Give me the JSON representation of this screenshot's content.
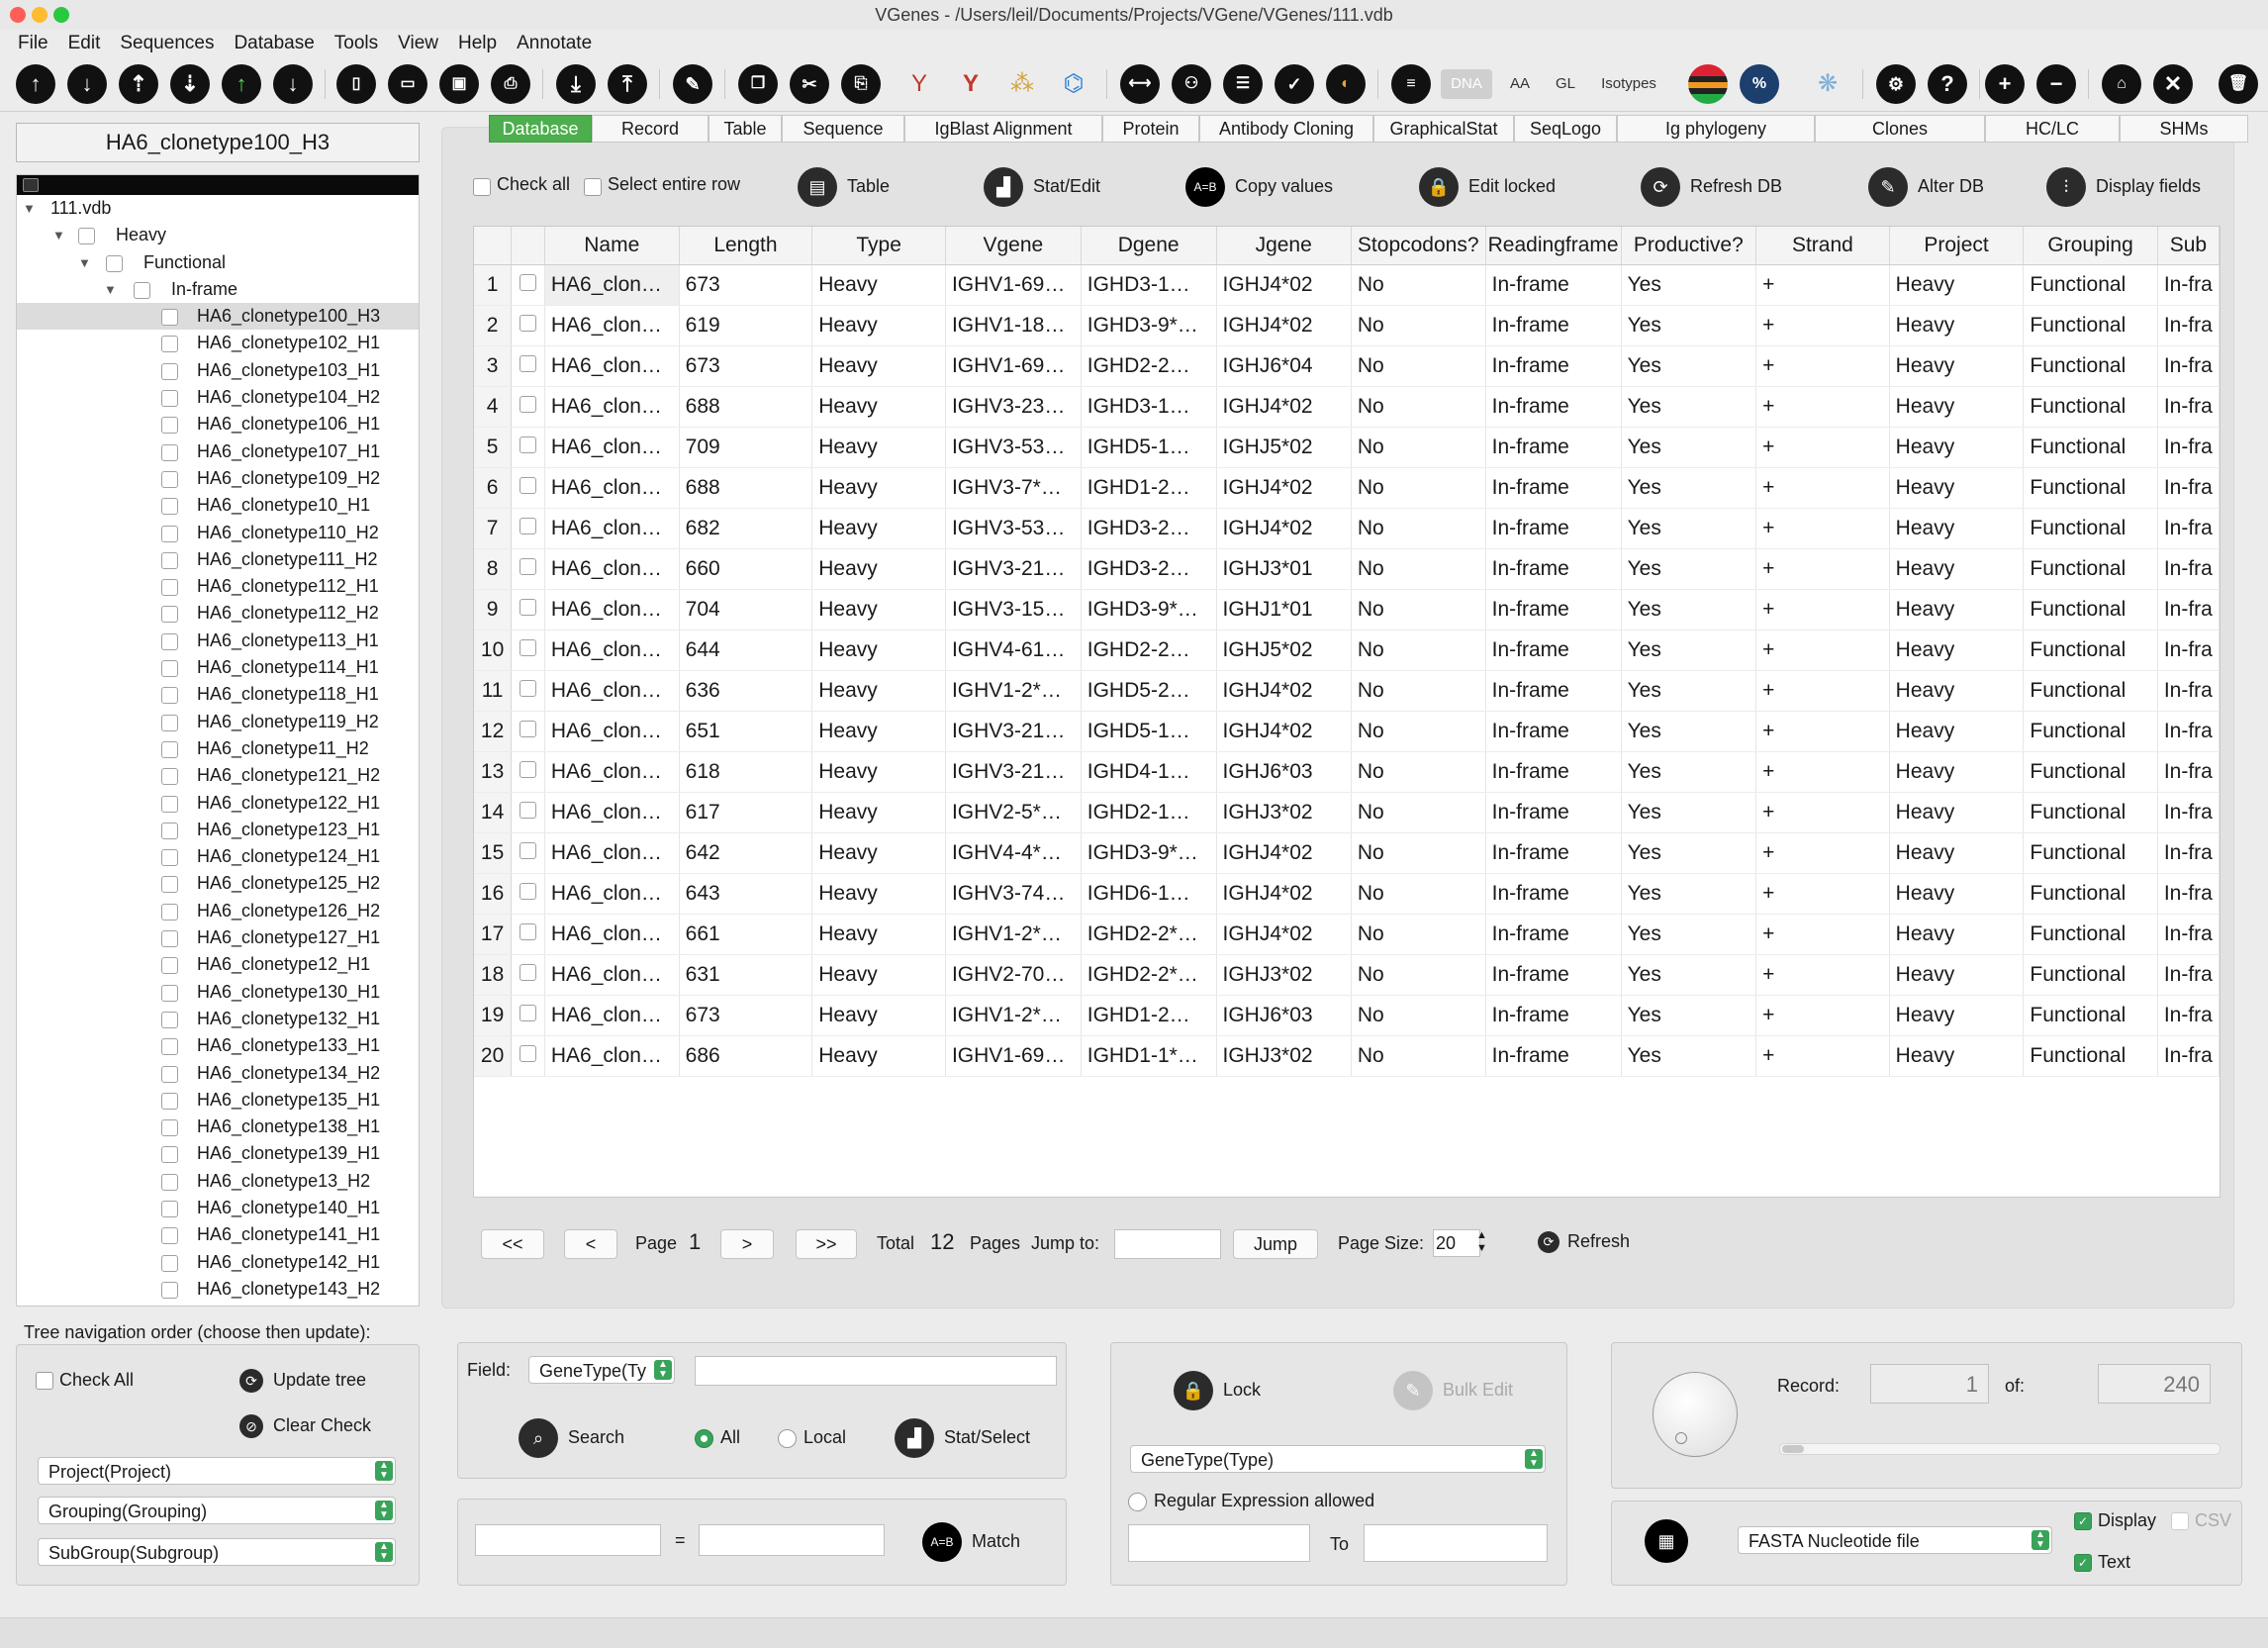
{
  "window": {
    "title": "VGenes - /Users/leil/Documents/Projects/VGene/VGenes/111.vdb"
  },
  "menu": [
    "File",
    "Edit",
    "Sequences",
    "Database",
    "Tools",
    "View",
    "Help",
    "Annotate"
  ],
  "toolbar": {
    "dna": "DNA",
    "aa": "AA",
    "gl": "GL",
    "isotypes": "Isotypes"
  },
  "sequence_name": "HA6_clonetype100_H3",
  "tree": {
    "root": "111.vdb",
    "level1": "Heavy",
    "level2": "Functional",
    "level3": "In-frame",
    "leaves": [
      "HA6_clonetype100_H3",
      "HA6_clonetype102_H1",
      "HA6_clonetype103_H1",
      "HA6_clonetype104_H2",
      "HA6_clonetype106_H1",
      "HA6_clonetype107_H1",
      "HA6_clonetype109_H2",
      "HA6_clonetype10_H1",
      "HA6_clonetype110_H2",
      "HA6_clonetype111_H2",
      "HA6_clonetype112_H1",
      "HA6_clonetype112_H2",
      "HA6_clonetype113_H1",
      "HA6_clonetype114_H1",
      "HA6_clonetype118_H1",
      "HA6_clonetype119_H2",
      "HA6_clonetype11_H2",
      "HA6_clonetype121_H2",
      "HA6_clonetype122_H1",
      "HA6_clonetype123_H1",
      "HA6_clonetype124_H1",
      "HA6_clonetype125_H2",
      "HA6_clonetype126_H2",
      "HA6_clonetype127_H1",
      "HA6_clonetype12_H1",
      "HA6_clonetype130_H1",
      "HA6_clonetype132_H1",
      "HA6_clonetype133_H1",
      "HA6_clonetype134_H2",
      "HA6_clonetype135_H1",
      "HA6_clonetype138_H1",
      "HA6_clonetype139_H1",
      "HA6_clonetype13_H2",
      "HA6_clonetype140_H1",
      "HA6_clonetype141_H1",
      "HA6_clonetype142_H1",
      "HA6_clonetype143_H2"
    ]
  },
  "tabs": [
    "Database",
    "Record",
    "Table",
    "Sequence",
    "IgBlast Alignment",
    "Protein",
    "Antibody Cloning",
    "GraphicalStat",
    "SeqLogo",
    "Ig phylogeny",
    "Clones",
    "HC/LC",
    "SHMs"
  ],
  "db_controls": {
    "check_all": "Check all",
    "select_row": "Select entire row",
    "table": "Table",
    "stat_edit": "Stat/Edit",
    "copy_values": "Copy values",
    "edit_locked": "Edit locked",
    "refresh_db": "Refresh DB",
    "alter_db": "Alter DB",
    "display_fields": "Display fields"
  },
  "grid": {
    "columns": [
      "Name",
      "Length",
      "Type",
      "Vgene",
      "Dgene",
      "Jgene",
      "Stopcodons?",
      "Readingframe",
      "Productive?",
      "Strand",
      "Project",
      "Grouping",
      "Sub"
    ],
    "rows": [
      [
        "1",
        "HA6_clon…",
        "673",
        "Heavy",
        "IGHV1-69…",
        "IGHD3-1…",
        "IGHJ4*02",
        "No",
        "In-frame",
        "Yes",
        "+",
        "Heavy",
        "Functional",
        "In-fra"
      ],
      [
        "2",
        "HA6_clon…",
        "619",
        "Heavy",
        "IGHV1-18…",
        "IGHD3-9*…",
        "IGHJ4*02",
        "No",
        "In-frame",
        "Yes",
        "+",
        "Heavy",
        "Functional",
        "In-fra"
      ],
      [
        "3",
        "HA6_clon…",
        "673",
        "Heavy",
        "IGHV1-69…",
        "IGHD2-2…",
        "IGHJ6*04",
        "No",
        "In-frame",
        "Yes",
        "+",
        "Heavy",
        "Functional",
        "In-fra"
      ],
      [
        "4",
        "HA6_clon…",
        "688",
        "Heavy",
        "IGHV3-23…",
        "IGHD3-1…",
        "IGHJ4*02",
        "No",
        "In-frame",
        "Yes",
        "+",
        "Heavy",
        "Functional",
        "In-fra"
      ],
      [
        "5",
        "HA6_clon…",
        "709",
        "Heavy",
        "IGHV3-53…",
        "IGHD5-1…",
        "IGHJ5*02",
        "No",
        "In-frame",
        "Yes",
        "+",
        "Heavy",
        "Functional",
        "In-fra"
      ],
      [
        "6",
        "HA6_clon…",
        "688",
        "Heavy",
        "IGHV3-7*…",
        "IGHD1-2…",
        "IGHJ4*02",
        "No",
        "In-frame",
        "Yes",
        "+",
        "Heavy",
        "Functional",
        "In-fra"
      ],
      [
        "7",
        "HA6_clon…",
        "682",
        "Heavy",
        "IGHV3-53…",
        "IGHD3-2…",
        "IGHJ4*02",
        "No",
        "In-frame",
        "Yes",
        "+",
        "Heavy",
        "Functional",
        "In-fra"
      ],
      [
        "8",
        "HA6_clon…",
        "660",
        "Heavy",
        "IGHV3-21…",
        "IGHD3-2…",
        "IGHJ3*01",
        "No",
        "In-frame",
        "Yes",
        "+",
        "Heavy",
        "Functional",
        "In-fra"
      ],
      [
        "9",
        "HA6_clon…",
        "704",
        "Heavy",
        "IGHV3-15…",
        "IGHD3-9*…",
        "IGHJ1*01",
        "No",
        "In-frame",
        "Yes",
        "+",
        "Heavy",
        "Functional",
        "In-fra"
      ],
      [
        "10",
        "HA6_clon…",
        "644",
        "Heavy",
        "IGHV4-61…",
        "IGHD2-2…",
        "IGHJ5*02",
        "No",
        "In-frame",
        "Yes",
        "+",
        "Heavy",
        "Functional",
        "In-fra"
      ],
      [
        "11",
        "HA6_clon…",
        "636",
        "Heavy",
        "IGHV1-2*…",
        "IGHD5-2…",
        "IGHJ4*02",
        "No",
        "In-frame",
        "Yes",
        "+",
        "Heavy",
        "Functional",
        "In-fra"
      ],
      [
        "12",
        "HA6_clon…",
        "651",
        "Heavy",
        "IGHV3-21…",
        "IGHD5-1…",
        "IGHJ4*02",
        "No",
        "In-frame",
        "Yes",
        "+",
        "Heavy",
        "Functional",
        "In-fra"
      ],
      [
        "13",
        "HA6_clon…",
        "618",
        "Heavy",
        "IGHV3-21…",
        "IGHD4-1…",
        "IGHJ6*03",
        "No",
        "In-frame",
        "Yes",
        "+",
        "Heavy",
        "Functional",
        "In-fra"
      ],
      [
        "14",
        "HA6_clon…",
        "617",
        "Heavy",
        "IGHV2-5*…",
        "IGHD2-1…",
        "IGHJ3*02",
        "No",
        "In-frame",
        "Yes",
        "+",
        "Heavy",
        "Functional",
        "In-fra"
      ],
      [
        "15",
        "HA6_clon…",
        "642",
        "Heavy",
        "IGHV4-4*…",
        "IGHD3-9*…",
        "IGHJ4*02",
        "No",
        "In-frame",
        "Yes",
        "+",
        "Heavy",
        "Functional",
        "In-fra"
      ],
      [
        "16",
        "HA6_clon…",
        "643",
        "Heavy",
        "IGHV3-74…",
        "IGHD6-1…",
        "IGHJ4*02",
        "No",
        "In-frame",
        "Yes",
        "+",
        "Heavy",
        "Functional",
        "In-fra"
      ],
      [
        "17",
        "HA6_clon…",
        "661",
        "Heavy",
        "IGHV1-2*…",
        "IGHD2-2*…",
        "IGHJ4*02",
        "No",
        "In-frame",
        "Yes",
        "+",
        "Heavy",
        "Functional",
        "In-fra"
      ],
      [
        "18",
        "HA6_clon…",
        "631",
        "Heavy",
        "IGHV2-70…",
        "IGHD2-2*…",
        "IGHJ3*02",
        "No",
        "In-frame",
        "Yes",
        "+",
        "Heavy",
        "Functional",
        "In-fra"
      ],
      [
        "19",
        "HA6_clon…",
        "673",
        "Heavy",
        "IGHV1-2*…",
        "IGHD1-2…",
        "IGHJ6*03",
        "No",
        "In-frame",
        "Yes",
        "+",
        "Heavy",
        "Functional",
        "In-fra"
      ],
      [
        "20",
        "HA6_clon…",
        "686",
        "Heavy",
        "IGHV1-69…",
        "IGHD1-1*…",
        "IGHJ3*02",
        "No",
        "In-frame",
        "Yes",
        "+",
        "Heavy",
        "Functional",
        "In-fra"
      ]
    ]
  },
  "pager": {
    "first": "<<",
    "prev": "<",
    "page_label": "Page",
    "page": "1",
    "next": ">",
    "last": ">>",
    "total_label": "Total",
    "total": "12",
    "pages_label": "Pages",
    "jump_to_label": "Jump to:",
    "jump_value": "",
    "jump_button": "Jump",
    "page_size_label": "Page Size:",
    "page_size": "20",
    "refresh": "Refresh"
  },
  "tree_nav": {
    "label": "Tree navigation order (choose then update):",
    "check_all": "Check All",
    "update_tree": "Update tree",
    "clear_check": "Clear Check",
    "level1": "Project(Project)",
    "level2": "Grouping(Grouping)",
    "level3": "SubGroup(Subgroup)"
  },
  "search": {
    "field_label": "Field:",
    "field_value": "GeneType(Ty",
    "query": "",
    "search_button": "Search",
    "scope_all": "All",
    "scope_local": "Local",
    "stat_select": "Stat/Select",
    "match_left": "",
    "equals": "=",
    "match_right": "",
    "match_button": "Match"
  },
  "edit": {
    "lock": "Lock",
    "bulk_edit": "Bulk Edit",
    "field_value": "GeneType(Type)",
    "regex_label": "Regular Expression allowed",
    "from_value": "",
    "to_label": "To",
    "to_value": ""
  },
  "record": {
    "label": "Record:",
    "value": "1",
    "of_label": "of:",
    "total": "240"
  },
  "export": {
    "format": "FASTA Nucleotide file",
    "display": "Display",
    "csv": "CSV",
    "text": "Text"
  }
}
